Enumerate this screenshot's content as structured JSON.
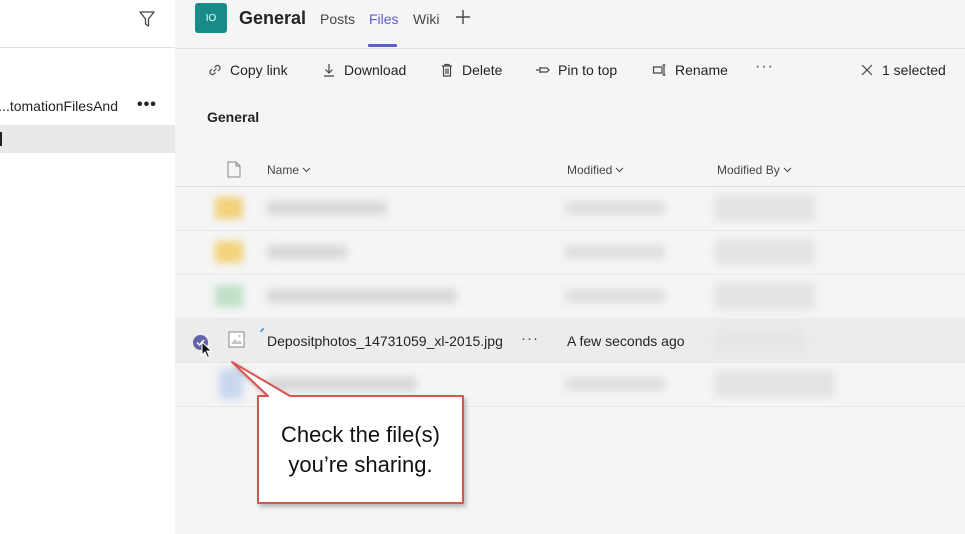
{
  "sidebar": {
    "team_name": "tomationFilesAnd...",
    "team_more": "•••",
    "channel_marker": "l"
  },
  "header": {
    "avatar_initials": "IO",
    "channel": "General",
    "tabs": [
      {
        "label": "Posts"
      },
      {
        "label": "Files"
      },
      {
        "label": "Wiki"
      }
    ]
  },
  "toolbar": {
    "items": [
      {
        "label": "Copy link",
        "icon": "link-icon"
      },
      {
        "label": "Download",
        "icon": "download-icon"
      },
      {
        "label": "Delete",
        "icon": "trash-icon"
      },
      {
        "label": "Pin to top",
        "icon": "pin-icon"
      },
      {
        "label": "Rename",
        "icon": "rename-icon"
      }
    ],
    "more": "···",
    "selected_text": "1 selected"
  },
  "section_title": "General",
  "list": {
    "columns": {
      "name": "Name",
      "modified": "Modified",
      "modified_by": "Modified By"
    },
    "selected_file": {
      "name": "Depositphotos_14731059_xl-2015.jpg",
      "more": "···",
      "modified": "A few seconds ago"
    }
  },
  "callout": {
    "line1": "Check the file(s)",
    "line2": "you’re sharing."
  },
  "colors": {
    "accent": "#5b5fc7",
    "avatar": "#178a8a",
    "callout_border": "#d9534f"
  }
}
